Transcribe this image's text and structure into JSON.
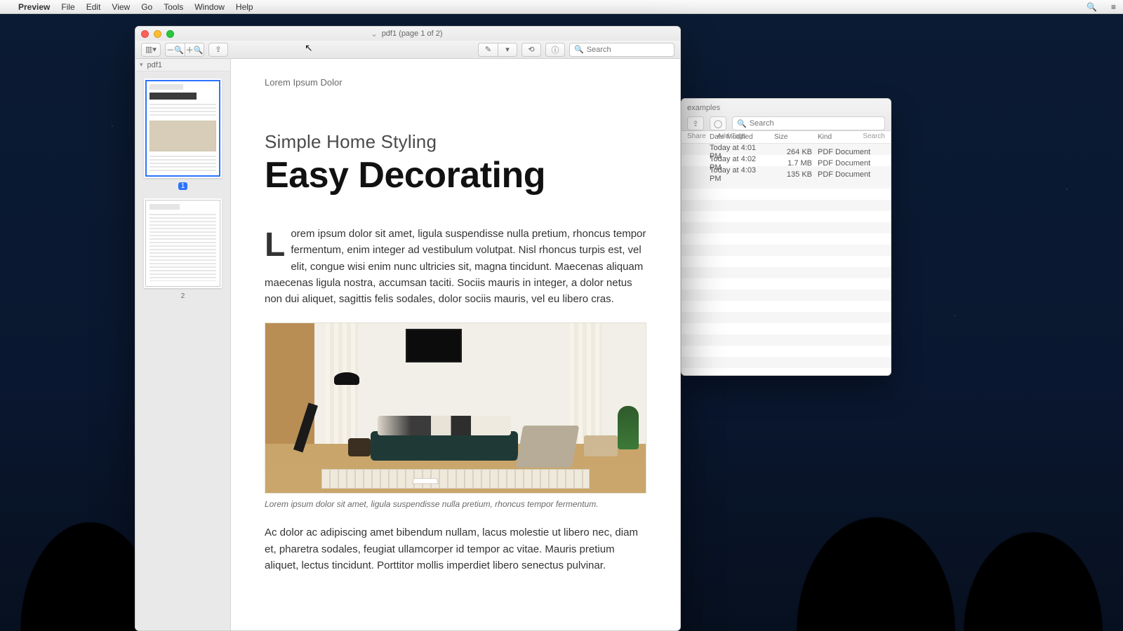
{
  "menubar": {
    "app": "Preview",
    "items": [
      "File",
      "Edit",
      "View",
      "Go",
      "Tools",
      "Window",
      "Help"
    ]
  },
  "preview": {
    "window": {
      "title": "pdf1 (page 1 of 2)"
    },
    "toolbar": {
      "sidebar_tip": "Sidebar",
      "zoom_out_tip": "Zoom Out",
      "zoom_in_tip": "Zoom In",
      "share_tip": "Share",
      "markup_tip": "Markup",
      "rotate_tip": "Rotate",
      "info_tip": "Inspector",
      "search_placeholder": "Search"
    },
    "sidebar": {
      "file_label": "pdf1",
      "pages": [
        {
          "number": "1",
          "selected": true
        },
        {
          "number": "2",
          "selected": false
        }
      ]
    },
    "document": {
      "running_head": "Lorem Ipsum Dolor",
      "kicker": "Simple Home Styling",
      "headline": "Easy Decorating",
      "lede": "Lorem ipsum dolor sit amet, ligula suspendisse nulla pretium, rhoncus tempor fermentum, enim integer ad vestibulum volutpat. Nisl rhoncus turpis est, vel elit, congue wisi enim nunc ultricies sit, magna tincidunt. Maecenas aliquam maecenas ligula nostra, accumsan taciti. Sociis mauris in integer, a dolor netus non dui aliquet, sagittis felis sodales, dolor sociis mauris, vel eu libero cras.",
      "caption": "Lorem ipsum dolor sit amet, ligula suspendisse nulla pretium, rhoncus tempor fermentum.",
      "para2": "Ac dolor ac adipiscing amet bibendum nullam, lacus molestie ut libero nec, diam et, pharetra sodales, feugiat ullamcorper id tempor ac vitae. Mauris pretium aliquet, lectus tincidunt. Porttitor mollis imperdiet libero senectus pulvinar."
    }
  },
  "finder": {
    "title": "examples",
    "toolbar": {
      "share_label": "Share",
      "tags_label": "Add Tags",
      "search_label": "Search",
      "search_placeholder": "Search"
    },
    "columns": {
      "date": "Date Modified",
      "size": "Size",
      "kind": "Kind"
    },
    "rows": [
      {
        "date": "Today at 4:01 PM",
        "size": "264 KB",
        "kind": "PDF Document"
      },
      {
        "date": "Today at 4:02 PM",
        "size": "1.7 MB",
        "kind": "PDF Document"
      },
      {
        "date": "Today at 4:03 PM",
        "size": "135 KB",
        "kind": "PDF Document"
      }
    ]
  }
}
